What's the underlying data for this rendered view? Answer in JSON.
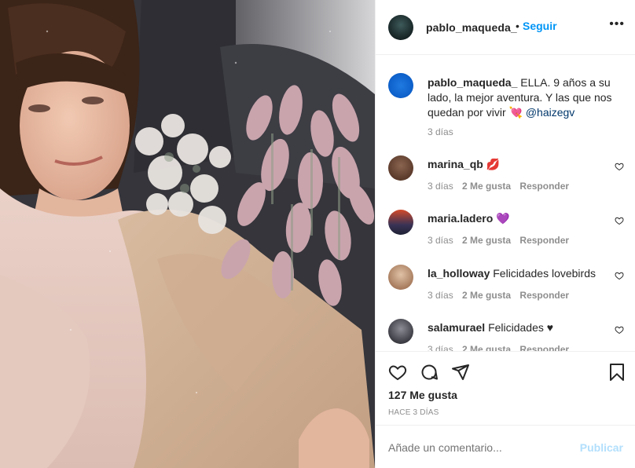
{
  "post": {
    "author": "pablo_maqueda_",
    "separator": "•",
    "follow_label": "Seguir",
    "more_label": "•••",
    "caption_prefix": "ELLA. 9 años a su lado, la mejor aventura. Y las que nos quedan por vivir",
    "caption_emoji": "💘",
    "caption_mention": "@haizegv",
    "caption_time": "3 días"
  },
  "comments": [
    {
      "user": "marina_qb",
      "text": "",
      "emoji": "💋",
      "time": "3 días",
      "likes": "2 Me gusta",
      "reply": "Responder",
      "avatar_color": "#6b4a3a"
    },
    {
      "user": "maria.ladero",
      "text": "",
      "emoji": "💜",
      "time": "3 días",
      "likes": "2 Me gusta",
      "reply": "Responder",
      "avatar_color": "#c0502a"
    },
    {
      "user": "la_holloway",
      "text": "Felicidades lovebirds",
      "emoji": "",
      "time": "3 días",
      "likes": "2 Me gusta",
      "reply": "Responder",
      "avatar_color": "#b58a6a"
    },
    {
      "user": "salamurael",
      "text": "Felicidades ♥",
      "emoji": "",
      "time": "3 días",
      "likes": "2 Me gusta",
      "reply": "Responder",
      "avatar_color": "#4a4a55"
    }
  ],
  "actions": {
    "likes_count": "127 Me gusta",
    "date": "HACE 3 DÍAS"
  },
  "add_comment": {
    "placeholder": "Añade un comentario...",
    "publish_label": "Publicar"
  },
  "icons": [
    "heart-icon",
    "comment-icon",
    "share-icon",
    "bookmark-icon",
    "more-options-icon",
    "small-heart-icon"
  ],
  "colors": {
    "link": "#0095f6",
    "publish_disabled": "#b2dffc",
    "muted": "#8e8e8e",
    "text": "#262626"
  }
}
